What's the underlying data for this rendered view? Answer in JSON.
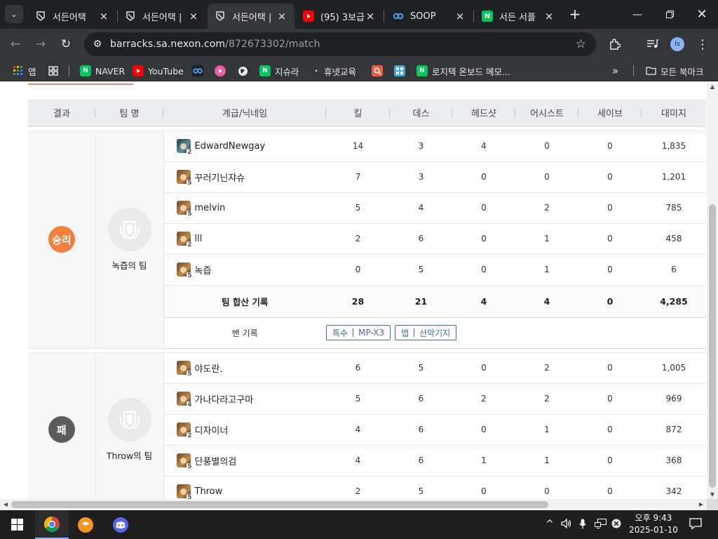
{
  "browser": {
    "tabs": [
      {
        "title": "서든어택",
        "favicon": "sudden-attack-icon",
        "active": false
      },
      {
        "title": "서든어택 |",
        "favicon": "sudden-attack-icon",
        "active": false
      },
      {
        "title": "서든어택 |",
        "favicon": "sudden-attack-icon",
        "active": true
      },
      {
        "title": "(95) 3보급",
        "favicon": "youtube-icon",
        "active": false
      },
      {
        "title": "SOOP",
        "favicon": "soop-icon",
        "active": false
      },
      {
        "title": "서든 서플",
        "favicon": "naver-icon",
        "active": false
      }
    ],
    "url_host": "barracks.sa.nexon.com",
    "url_path": "/872673302/match",
    "profile_initial": "ls"
  },
  "bookmarks": [
    {
      "label": "앱",
      "icon": "apps-icon"
    },
    {
      "label": "",
      "icon": "grid-icon"
    },
    {
      "label": "NAVER",
      "icon": "naver-icon"
    },
    {
      "label": "YouTube",
      "icon": "youtube-icon"
    },
    {
      "label": "",
      "icon": "soop-icon"
    },
    {
      "label": "",
      "icon": "play-icon"
    },
    {
      "label": "",
      "icon": "globe-icon"
    },
    {
      "label": "지슈라",
      "icon": "naver-icon"
    },
    {
      "label": "휴넷교육",
      "icon": "dot-icon"
    },
    {
      "label": "",
      "icon": "search-icon"
    },
    {
      "label": "",
      "icon": "puzzle-icon"
    },
    {
      "label": "로지텍 온보드 메모...",
      "icon": "naver-icon"
    }
  ],
  "bookmarks_all": "모든 북마크",
  "table": {
    "headers": [
      "결과",
      "팀 명",
      "계급/닉네임",
      "킬",
      "데스",
      "헤드샷",
      "어시스트",
      "세이브",
      "대미지"
    ],
    "teams": [
      {
        "result": "승리",
        "name": "녹즙의 팀",
        "players": [
          {
            "nick": "EdwardNewgay",
            "rank": "2",
            "rank_style": "blue",
            "kill": "14",
            "death": "3",
            "headshot": "4",
            "assist": "0",
            "save": "0",
            "damage": "1,835"
          },
          {
            "nick": "꾸러기닌쟈슈",
            "rank": "5",
            "rank_style": "gold",
            "kill": "7",
            "death": "3",
            "headshot": "0",
            "assist": "0",
            "save": "0",
            "damage": "1,201"
          },
          {
            "nick": "melvin",
            "rank": "5",
            "rank_style": "gold",
            "kill": "5",
            "death": "4",
            "headshot": "0",
            "assist": "2",
            "save": "0",
            "damage": "785"
          },
          {
            "nick": "lll",
            "rank": "2",
            "rank_style": "gold",
            "kill": "2",
            "death": "6",
            "headshot": "0",
            "assist": "1",
            "save": "0",
            "damage": "458"
          },
          {
            "nick": "녹즙",
            "rank": "5",
            "rank_style": "gold",
            "kill": "0",
            "death": "5",
            "headshot": "0",
            "assist": "1",
            "save": "0",
            "damage": "6"
          }
        ],
        "total": {
          "label": "팀 합산 기록",
          "kill": "28",
          "death": "21",
          "headshot": "4",
          "assist": "4",
          "save": "0",
          "damage": "4,285"
        },
        "ban": {
          "label": "밴 기록",
          "tags": [
            {
              "type": "특수",
              "value": "MP-X3"
            },
            {
              "type": "맵",
              "value": "산악기지"
            }
          ]
        }
      },
      {
        "result": "패",
        "name": "Throw의 팀",
        "players": [
          {
            "nick": "야도란.",
            "rank": "5",
            "rank_style": "gold",
            "kill": "6",
            "death": "5",
            "headshot": "0",
            "assist": "2",
            "save": "0",
            "damage": "1,005"
          },
          {
            "nick": "가나다라고구마",
            "rank": "4",
            "rank_style": "gold",
            "kill": "5",
            "death": "6",
            "headshot": "2",
            "assist": "2",
            "save": "0",
            "damage": "969"
          },
          {
            "nick": "디자이너",
            "rank": "2",
            "rank_style": "gold",
            "kill": "4",
            "death": "6",
            "headshot": "0",
            "assist": "1",
            "save": "0",
            "damage": "872"
          },
          {
            "nick": "단풍별의검",
            "rank": "5",
            "rank_style": "gold",
            "kill": "4",
            "death": "6",
            "headshot": "1",
            "assist": "1",
            "save": "0",
            "damage": "368"
          },
          {
            "nick": "Throw",
            "rank": "5",
            "rank_style": "gold",
            "kill": "2",
            "death": "5",
            "headshot": "0",
            "assist": "0",
            "save": "0",
            "damage": "342"
          }
        ]
      }
    ]
  },
  "colors": {
    "win": "#f4803b",
    "loss": "#5c5c5c",
    "ban_tag": "#4667a8"
  },
  "taskbar": {
    "clock_time": "오후 9:43",
    "clock_date": "2025-01-10",
    "apps": [
      "windows-start-icon",
      "chrome-icon",
      "kakaotalk-icon",
      "discord-icon"
    ]
  }
}
